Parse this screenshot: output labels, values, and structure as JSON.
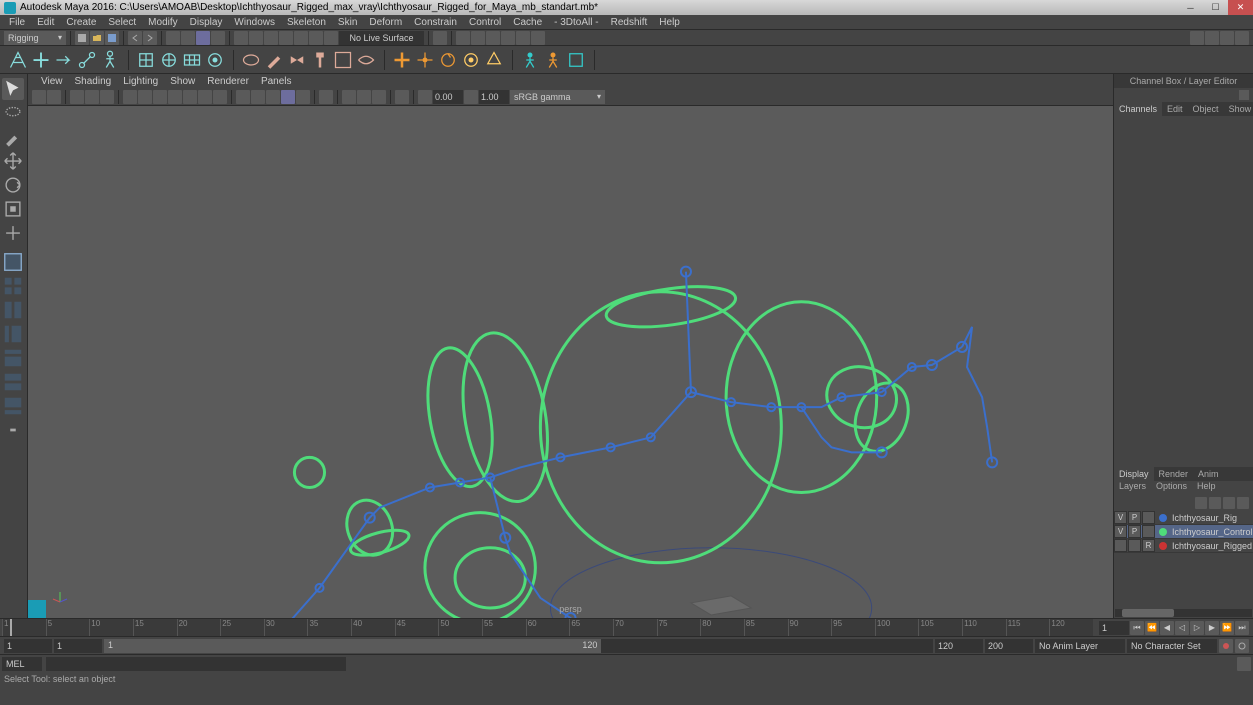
{
  "app_title": "Autodesk Maya 2016: C:\\Users\\AMOAB\\Desktop\\Ichthyosaur_Rigged_max_vray\\Ichthyosaur_Rigged_for_Maya_mb_standart.mb*",
  "menu": {
    "file": "File",
    "edit": "Edit",
    "create": "Create",
    "select": "Select",
    "modify": "Modify",
    "display": "Display",
    "windows": "Windows",
    "skeleton": "Skeleton",
    "skin": "Skin",
    "deform": "Deform",
    "constrain": "Constrain",
    "control": "Control",
    "cache": "Cache",
    "threedtoall": "- 3DtoAll -",
    "redshift": "Redshift",
    "help": "Help"
  },
  "mode_dropdown": "Rigging",
  "nolive": "No Live Surface",
  "panel_menu": {
    "view": "View",
    "shading": "Shading",
    "lighting": "Lighting",
    "show": "Show",
    "renderer": "Renderer",
    "panels": "Panels"
  },
  "panel_toolbar": {
    "n1": "0.00",
    "n2": "1.00",
    "cspace": "sRGB gamma"
  },
  "panel_label": "persp",
  "rp_title": "Channel Box / Layer Editor",
  "rp_tabs": {
    "channels": "Channels",
    "edit": "Edit",
    "object": "Object",
    "show": "Show"
  },
  "rp_btabs": {
    "display": "Display",
    "render": "Render",
    "anim": "Anim"
  },
  "rp_lmenu": {
    "layers": "Layers",
    "options": "Options",
    "help": "Help"
  },
  "layers": [
    {
      "v": "V",
      "p": "P",
      "r": "",
      "color": "#3b6fcc",
      "name": "Ichthyosaur_Rig",
      "selected": false
    },
    {
      "v": "V",
      "p": "P",
      "r": "",
      "color": "#4fdc7a",
      "name": "Ichthyosaur_Controlle",
      "selected": true
    },
    {
      "v": "",
      "p": "",
      "r": "R",
      "color": "#cc3333",
      "name": "Ichthyosaur_Rigged",
      "selected": false
    }
  ],
  "time": {
    "start": "1",
    "end": "120",
    "rstart": "1",
    "rend": "200",
    "noanim": "No Anim Layer",
    "nochar": "No Character Set",
    "ticks": [
      "1",
      "5",
      "10",
      "15",
      "20",
      "25",
      "30",
      "35",
      "40",
      "45",
      "50",
      "55",
      "60",
      "65",
      "70",
      "75",
      "80",
      "85",
      "90",
      "95",
      "100",
      "105",
      "110",
      "115",
      "120"
    ]
  },
  "cmd_label": "MEL",
  "helpline": "Select Tool: select an object",
  "colors": {
    "rig_ctrl": "#4fdc7a",
    "rig_bone": "#3b6fcc",
    "grid": "#6a6a6a",
    "ground": "#3b4a7a"
  }
}
